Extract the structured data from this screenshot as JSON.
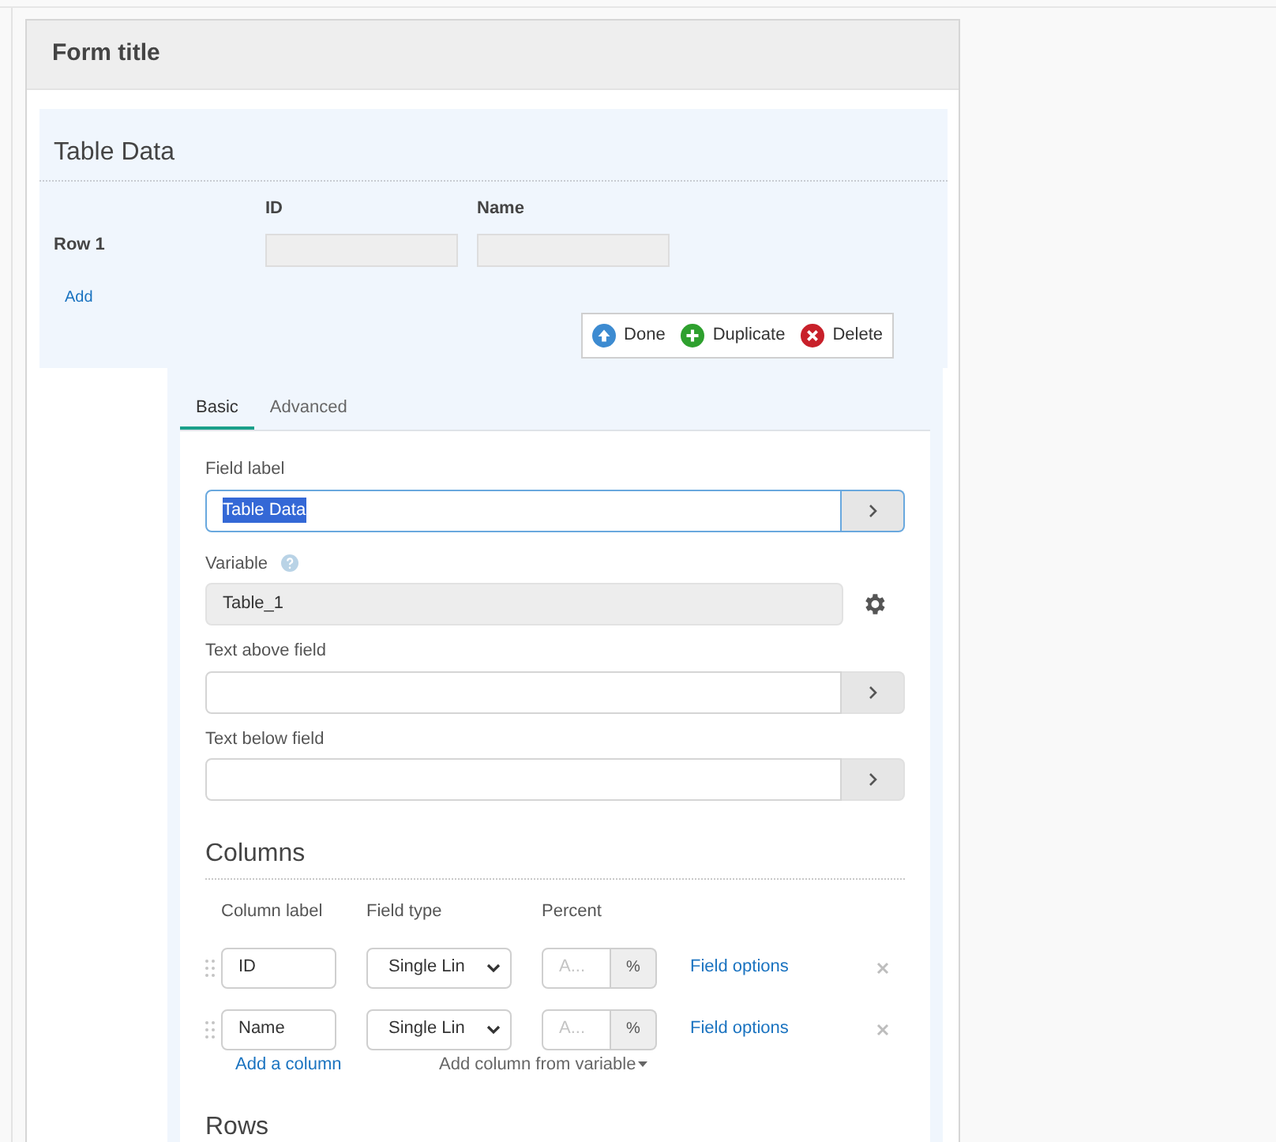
{
  "form_title": "Form title",
  "table_block": {
    "title": "Table Data",
    "columns": [
      "ID",
      "Name"
    ],
    "rows": [
      {
        "label": "Row 1"
      }
    ],
    "add_link": "Add"
  },
  "actions": [
    {
      "kind": "done",
      "label": "Done"
    },
    {
      "kind": "duplicate",
      "label": "Duplicate"
    },
    {
      "kind": "delete",
      "label": "Delete"
    }
  ],
  "tabs": [
    {
      "label": "Basic",
      "selected": true
    },
    {
      "label": "Advanced",
      "selected": false
    }
  ],
  "fields": [
    {
      "kind": "text",
      "label": "Field label",
      "value": "Table Data",
      "focused": true,
      "text_selected": true
    },
    {
      "kind": "variable",
      "label": "Variable",
      "value": "Table_1"
    },
    {
      "kind": "text",
      "label": "Text above field",
      "focused": false
    },
    {
      "kind": "text",
      "label": "Text below field",
      "focused": false
    }
  ],
  "columns_section": {
    "title": "Columns",
    "headers": [
      "Column label",
      "Field type",
      "Percent"
    ],
    "items": [
      {
        "label": "ID",
        "type": "Single Lin",
        "percent_placeholder": "A...",
        "unit": "%",
        "link": "Field options"
      },
      {
        "label": "Name",
        "type": "Single Lin",
        "percent_placeholder": "A...",
        "unit": "%",
        "link": "Field options"
      }
    ],
    "add_link": "Add a column",
    "add_from_variable": "Add column from variable"
  },
  "rows_section": {
    "title": "Rows"
  }
}
